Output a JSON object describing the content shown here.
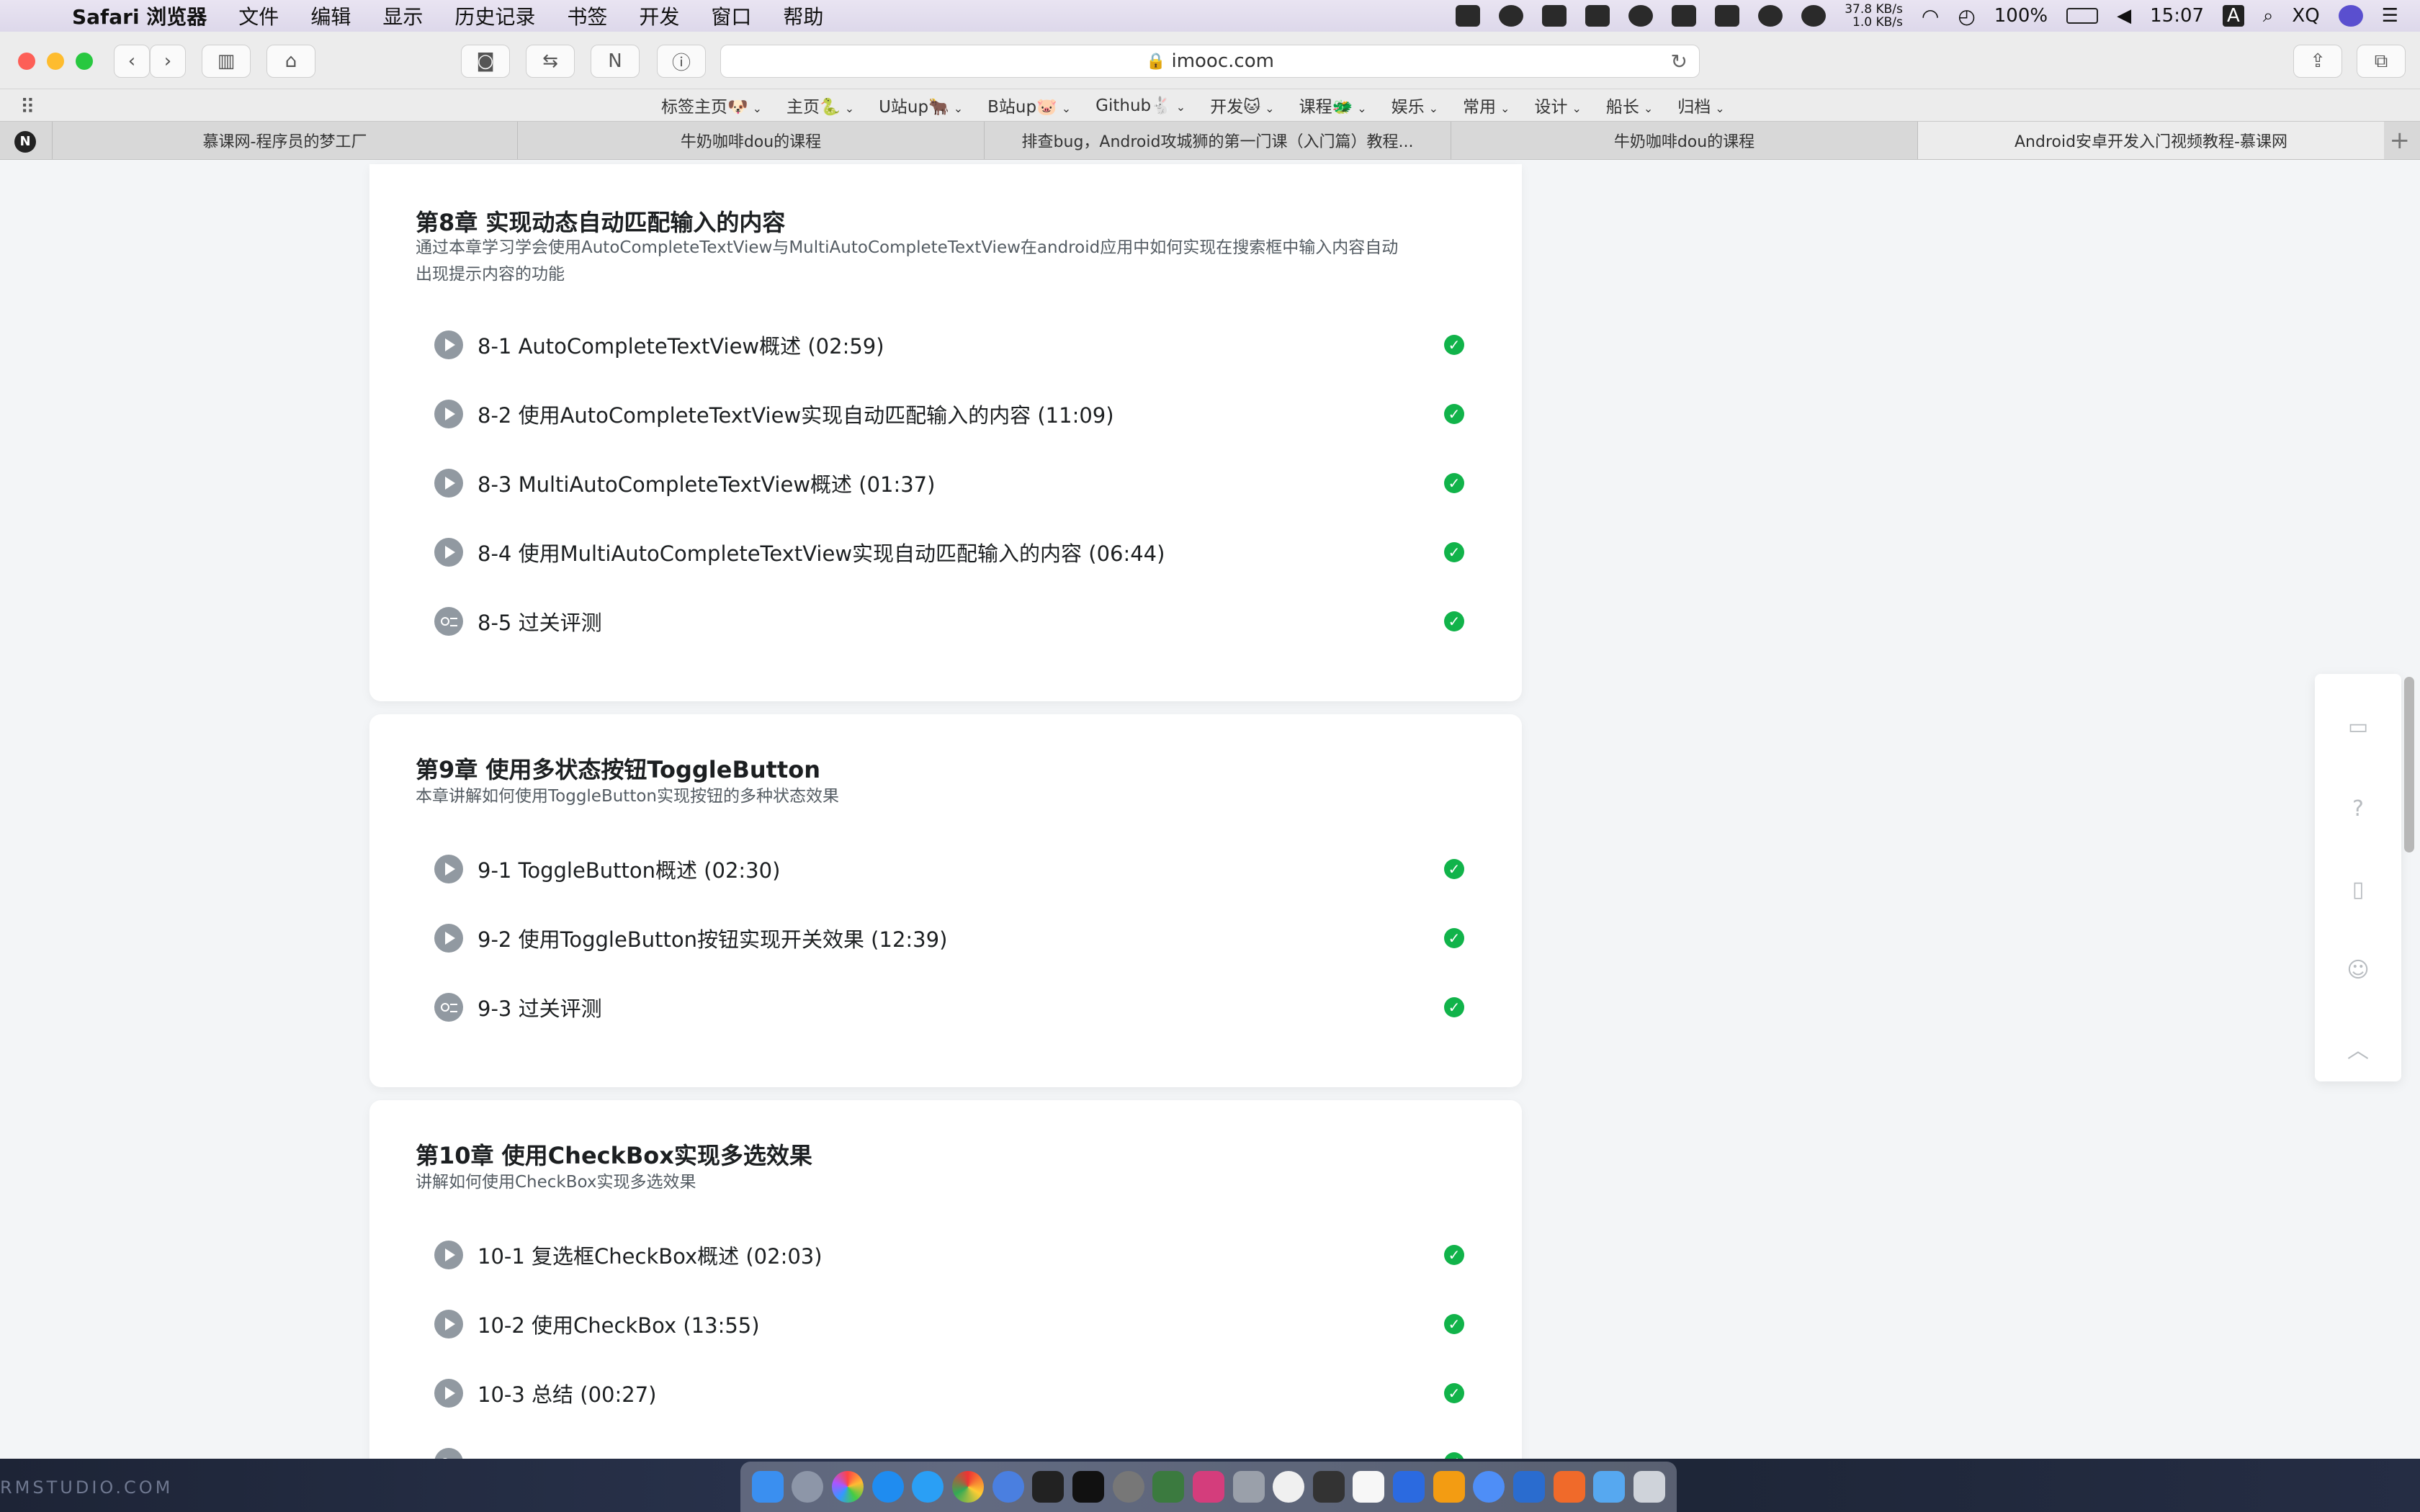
{
  "menubar": {
    "app_name": "Safari 浏览器",
    "items": [
      "文件",
      "编辑",
      "显示",
      "历史记录",
      "书签",
      "开发",
      "窗口",
      "帮助"
    ],
    "net_up": "37.8 KB/s",
    "net_down": "1.0 KB/s",
    "battery": "100%",
    "time": "15:07",
    "input_method": "A",
    "user": "XQ"
  },
  "toolbar": {
    "url": "imooc.com"
  },
  "bookmarks": [
    "标签主页🐶",
    "主页🐍",
    "U站up🐂",
    "B站up🐷",
    "Github🐇",
    "开发🐱",
    "课程🐲",
    "娱乐",
    "常用",
    "设计",
    "船长",
    "归档"
  ],
  "tabs": [
    "慕课网-程序员的梦工厂",
    "牛奶咖啡dou的课程",
    "排查bug，Android攻城狮的第一门课（入门篇）教程...",
    "牛奶咖啡dou的课程",
    "Android安卓开发入门视频教程-慕课网"
  ],
  "chapters": [
    {
      "title": "第8章 实现动态自动匹配输入的内容",
      "desc": "通过本章学习学会使用AutoCompleteTextView与MultiAutoCompleteTextView在android应用中如何实现在搜索框中输入内容自动出现提示内容的功能",
      "lessons": [
        {
          "label": "8-1 AutoCompleteTextView概述 (02:59)",
          "type": "video"
        },
        {
          "label": "8-2 使用AutoCompleteTextView实现自动匹配输入的内容 (11:09)",
          "type": "video"
        },
        {
          "label": "8-3 MultiAutoCompleteTextView概述 (01:37)",
          "type": "video"
        },
        {
          "label": "8-4 使用MultiAutoCompleteTextView实现自动匹配输入的内容 (06:44)",
          "type": "video"
        },
        {
          "label": "8-5 过关评测",
          "type": "quiz"
        }
      ]
    },
    {
      "title": "第9章 使用多状态按钮ToggleButton",
      "desc": "本章讲解如何使用ToggleButton实现按钮的多种状态效果",
      "lessons": [
        {
          "label": "9-1 ToggleButton概述 (02:30)",
          "type": "video"
        },
        {
          "label": "9-2 使用ToggleButton按钮实现开关效果 (12:39)",
          "type": "video"
        },
        {
          "label": "9-3 过关评测",
          "type": "quiz"
        }
      ]
    },
    {
      "title": "第10章 使用CheckBox实现多选效果",
      "desc": "讲解如何使用CheckBox实现多选效果",
      "lessons": [
        {
          "label": "10-1 复选框CheckBox概述 (02:03)",
          "type": "video"
        },
        {
          "label": "10-2 使用CheckBox (13:55)",
          "type": "video"
        },
        {
          "label": "10-3 总结 (00:27)",
          "type": "video"
        }
      ]
    }
  ],
  "status": {
    "check_color": "#11b34a"
  },
  "dock": {
    "watermark": "RMSTUDIO.COM"
  }
}
